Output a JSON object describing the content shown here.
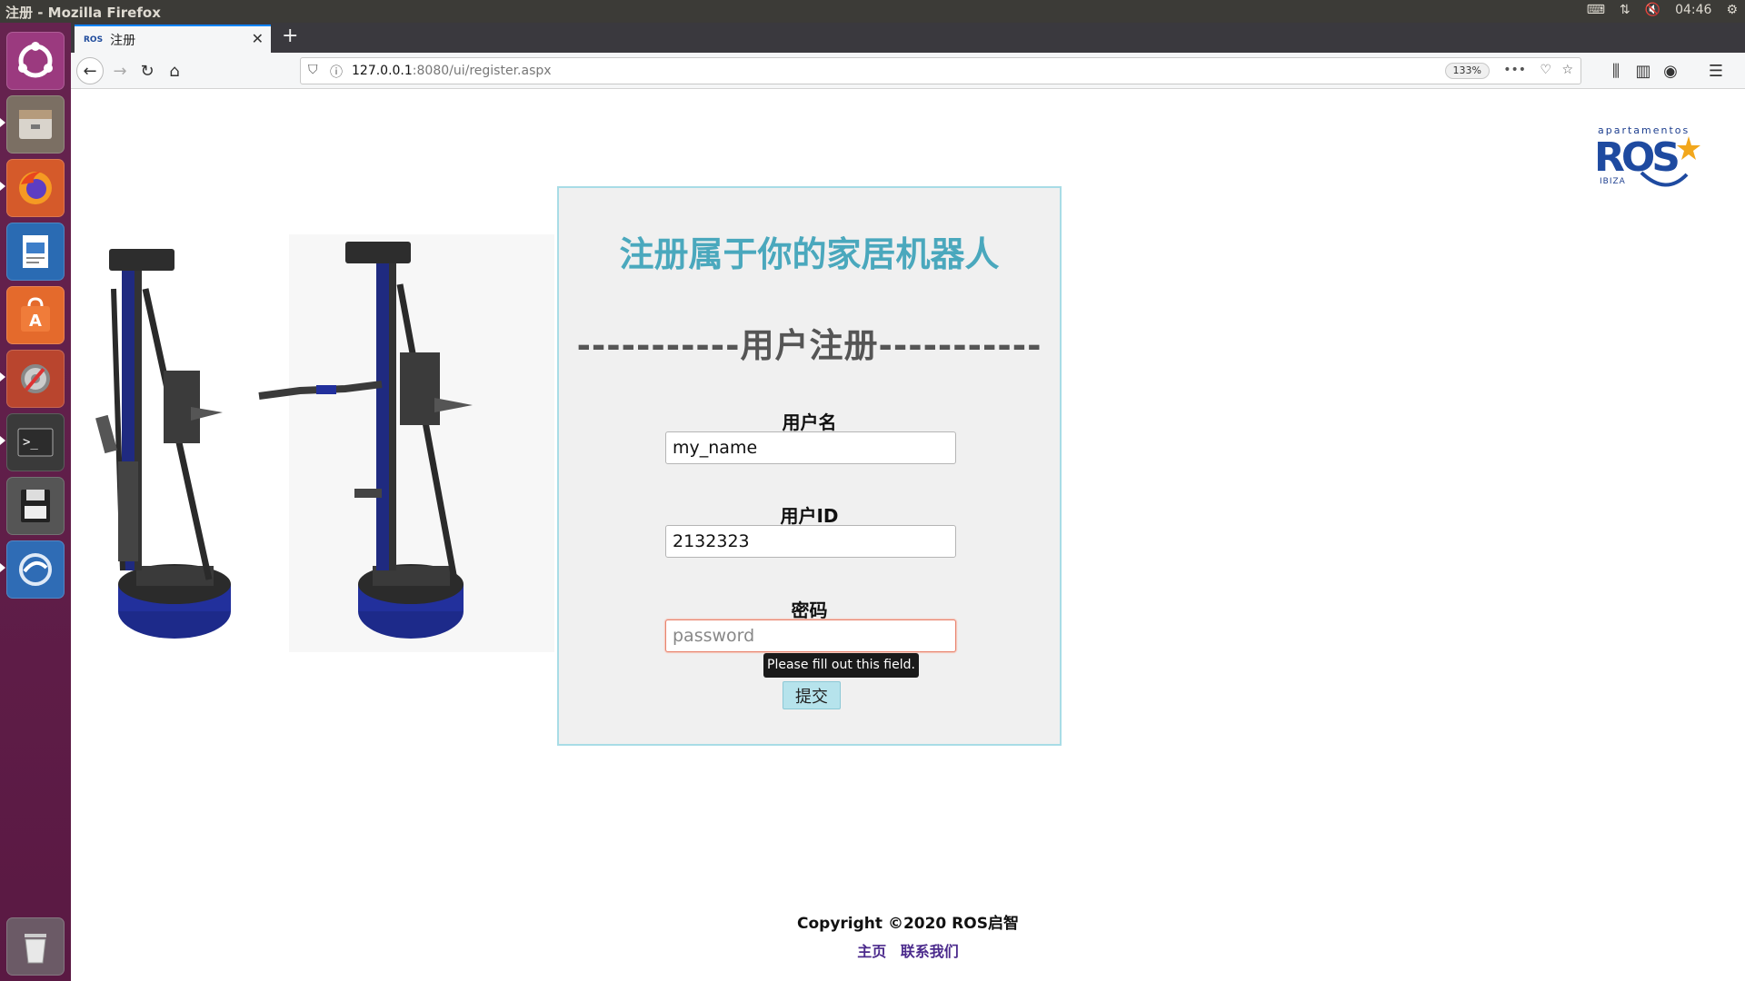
{
  "system": {
    "window_title": "注册 - Mozilla Firefox",
    "clock": "04:46"
  },
  "browser": {
    "tab_title": "注册",
    "tab_favicon": "ROS",
    "url_host": "127.0.0.1",
    "url_path": ":8080/ui/register.aspx",
    "zoom": "133%"
  },
  "launcher": {
    "items": [
      "ubuntu-home-icon",
      "files-icon",
      "firefox-icon",
      "writer-icon",
      "software-center-icon",
      "settings-icon",
      "terminal-icon",
      "save-disk-icon",
      "remote-icon",
      "trash-icon"
    ]
  },
  "page": {
    "logo_top": "apartamentos",
    "logo_main": "ROS",
    "logo_bottom": "IBIZA",
    "title": "注册属于你的家居机器人",
    "subtitle": "-----------用户注册-----------",
    "fields": {
      "username_label": "用户名",
      "username_value": "my_name",
      "userid_label": "用户ID",
      "userid_value": "2132323",
      "password_label": "密码",
      "password_placeholder": "password"
    },
    "validation_tooltip": "Please fill out this field.",
    "submit_label": "提交",
    "copyright": "Copyright ©2020 ROS启智",
    "footer_links": [
      "主页",
      "联系我们"
    ]
  },
  "colors": {
    "title": "#4aa8bd",
    "panel_border": "#a8dce6",
    "launcher": "#5e1a46",
    "link": "#4b2a8c"
  }
}
